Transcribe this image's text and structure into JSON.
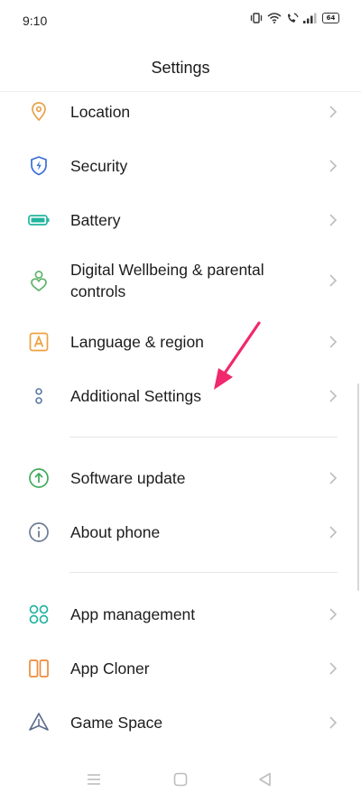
{
  "status_bar": {
    "time": "9:10",
    "battery_level": "64"
  },
  "header": {
    "title": "Settings"
  },
  "colors": {
    "location": "#E7A24B",
    "security": "#3C6FD8",
    "battery": "#21B59E",
    "wellbeing": "#5FB36A",
    "language": "#F0A040",
    "additional": "#5C79A8",
    "software": "#3FAA5A",
    "about": "#6B7C93",
    "app_management": "#21B4A0",
    "app_cloner": "#EE8A3A",
    "game_space": "#5C6C8C",
    "annotation_arrow": "#F0286E",
    "chevron": "#BDBDBD"
  },
  "sections": [
    {
      "items": [
        {
          "label": "Location",
          "icon": "location-pin-icon"
        },
        {
          "label": "Security",
          "icon": "shield-icon"
        },
        {
          "label": "Battery",
          "icon": "battery-icon"
        },
        {
          "label": "Digital Wellbeing & parental controls",
          "icon": "wellbeing-icon"
        },
        {
          "label": "Language & region",
          "icon": "language-icon"
        },
        {
          "label": "Additional Settings",
          "icon": "additional-settings-icon"
        }
      ]
    },
    {
      "items": [
        {
          "label": "Software update",
          "icon": "software-update-icon"
        },
        {
          "label": "About phone",
          "icon": "info-icon"
        }
      ]
    },
    {
      "items": [
        {
          "label": "App management",
          "icon": "app-management-icon"
        },
        {
          "label": "App Cloner",
          "icon": "app-cloner-icon"
        },
        {
          "label": "Game Space",
          "icon": "game-space-icon"
        }
      ]
    }
  ],
  "nav_bar": {
    "buttons": [
      "menu-icon",
      "home-icon",
      "back-icon"
    ]
  }
}
